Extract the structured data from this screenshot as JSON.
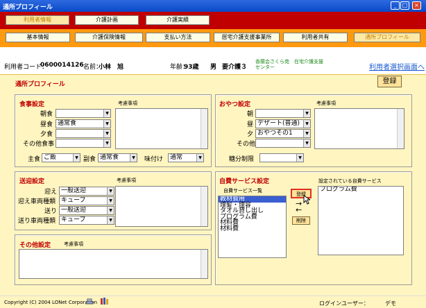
{
  "window": {
    "title": "通所プロフィール"
  },
  "topnav": {
    "items": [
      "利用者情報",
      "介護計画",
      "介護実績"
    ],
    "active": 0
  },
  "subnav": {
    "items": [
      "基本情報",
      "介護保険情報",
      "支払い方法",
      "居宅介護支援事業所",
      "利用者共有",
      "通所プロフィール"
    ],
    "active": 5
  },
  "info": {
    "code_label": "利用者コード：",
    "code": "0600014126",
    "name_label": "名前：",
    "name": "小林　旭",
    "age_label": "年齢：",
    "age": "93歳",
    "sex": "男",
    "care_level": "要介護３",
    "facility": "香蘭会さくら苑　在宅介護支援センター",
    "link": "利用者選択画面へ"
  },
  "page": {
    "title": "通所プロフィール",
    "register": "登録"
  },
  "meal": {
    "title": "食事設定",
    "note_label": "考慮事項",
    "rows": [
      {
        "label": "朝食",
        "value": ""
      },
      {
        "label": "昼食",
        "value": "通常食"
      },
      {
        "label": "夕食",
        "value": ""
      },
      {
        "label": "その他食事",
        "value": ""
      }
    ],
    "staple_label": "主食",
    "staple": "ご飯",
    "side_label": "副食",
    "side": "通常食",
    "taste_label": "味付け",
    "taste": "通常"
  },
  "snack": {
    "title": "おやつ設定",
    "note_label": "考慮事項",
    "rows": [
      {
        "label": "朝",
        "value": ""
      },
      {
        "label": "昼",
        "value": "デザート(普通)"
      },
      {
        "label": "夕",
        "value": "おやつその1"
      },
      {
        "label": "その他",
        "value": ""
      }
    ],
    "sugar_label": "糖分制限",
    "sugar": ""
  },
  "transport": {
    "title": "送迎設定",
    "note_label": "考慮事項",
    "rows": [
      {
        "label": "迎え",
        "value": "一般送迎"
      },
      {
        "label": "迎え車両種類",
        "value": "キューブ"
      },
      {
        "label": "送り",
        "value": "一般送迎"
      },
      {
        "label": "送り車両種類",
        "value": "キューブ"
      }
    ]
  },
  "other": {
    "title": "その他設定",
    "note_label": "考慮事項"
  },
  "selfpay": {
    "title": "自費サービス設定",
    "list_label": "自費サービス一覧",
    "set_label": "設定されている自費サービス",
    "items": [
      "教材費用",
      "理髪・理容",
      "タオル貸し出し",
      "プログラム費",
      "材料費",
      "材料費"
    ],
    "selected": 0,
    "set_items": [
      "プログラム費"
    ],
    "add_button": "登録",
    "right_arrow": "→",
    "left_arrow": "←",
    "delete_button": "削除"
  },
  "footer": {
    "copyright": "Copyright (C) 2004 LONet Corporation",
    "login_label": "ログインユーザー：",
    "login_user": "デモ"
  },
  "colors": {
    "titlebar": "#0a49c8",
    "topbar": "#c00000",
    "subbar": "#ff9a10",
    "panel": "#fff5c0",
    "heading": "#c00000",
    "highlight": "#3a5fd0"
  }
}
